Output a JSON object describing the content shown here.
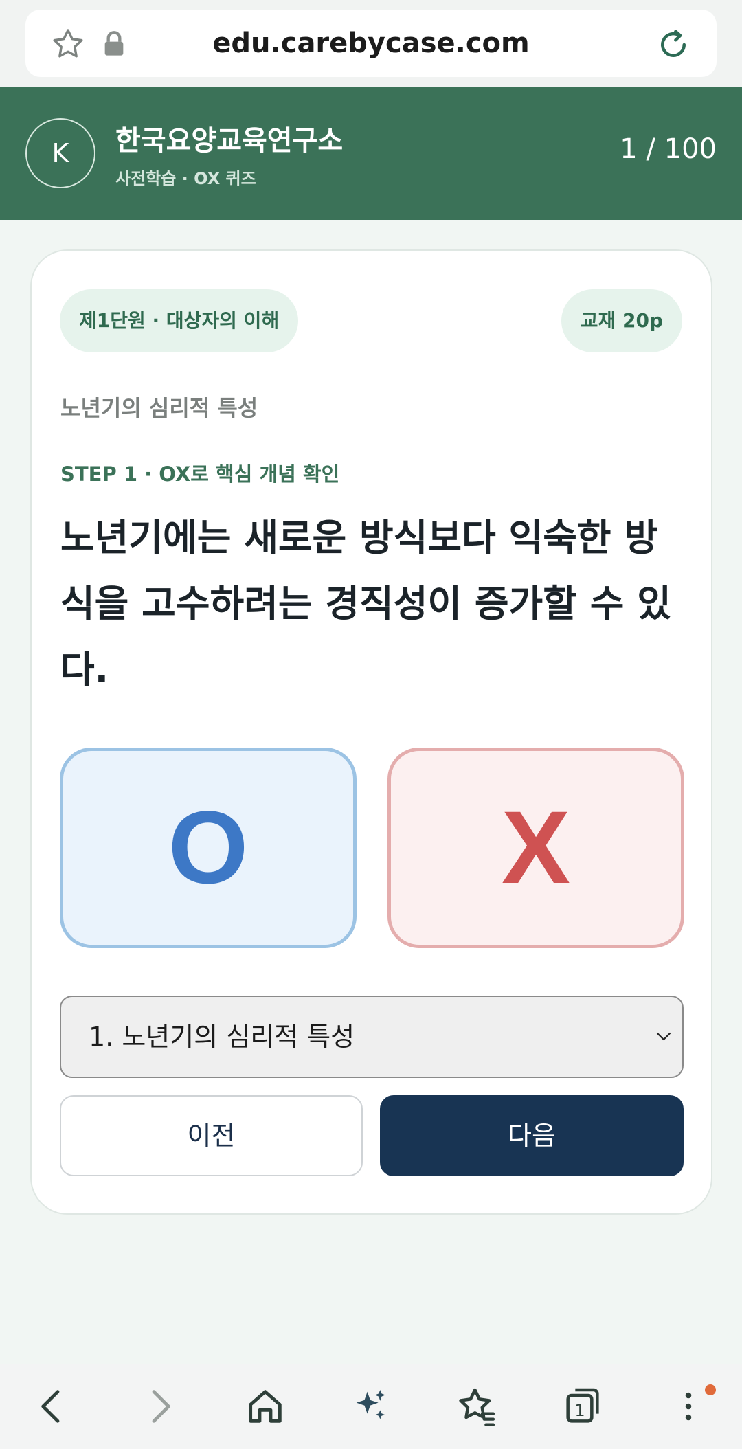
{
  "browser": {
    "url": "edu.carebycase.com"
  },
  "header": {
    "logo_letter": "K",
    "org_name": "한국요양교육연구소",
    "subtitle": "사전학습 · OX 퀴즈",
    "progress": "1 / 100"
  },
  "quiz": {
    "unit_chip": "제1단원 · 대상자의 이해",
    "page_chip": "교재 20p",
    "topic": "노년기의 심리적 특성",
    "step": "STEP 1 · OX로 핵심 개념 확인",
    "question": "노년기에는 새로운 방식보다 익숙한 방식을 고수하려는 경직성이 증가할 수 있다.",
    "option_o": "O",
    "option_x": "X",
    "select_value": "1. 노년기의 심리적 특성",
    "prev_label": "이전",
    "next_label": "다음"
  },
  "toolbar": {
    "tabs_count": "1"
  },
  "colors": {
    "header_green": "#3b7258",
    "o_blue": "#3d78c6",
    "x_red": "#cf5252",
    "next_navy": "#183453",
    "notification_dot": "#e06a3a"
  }
}
